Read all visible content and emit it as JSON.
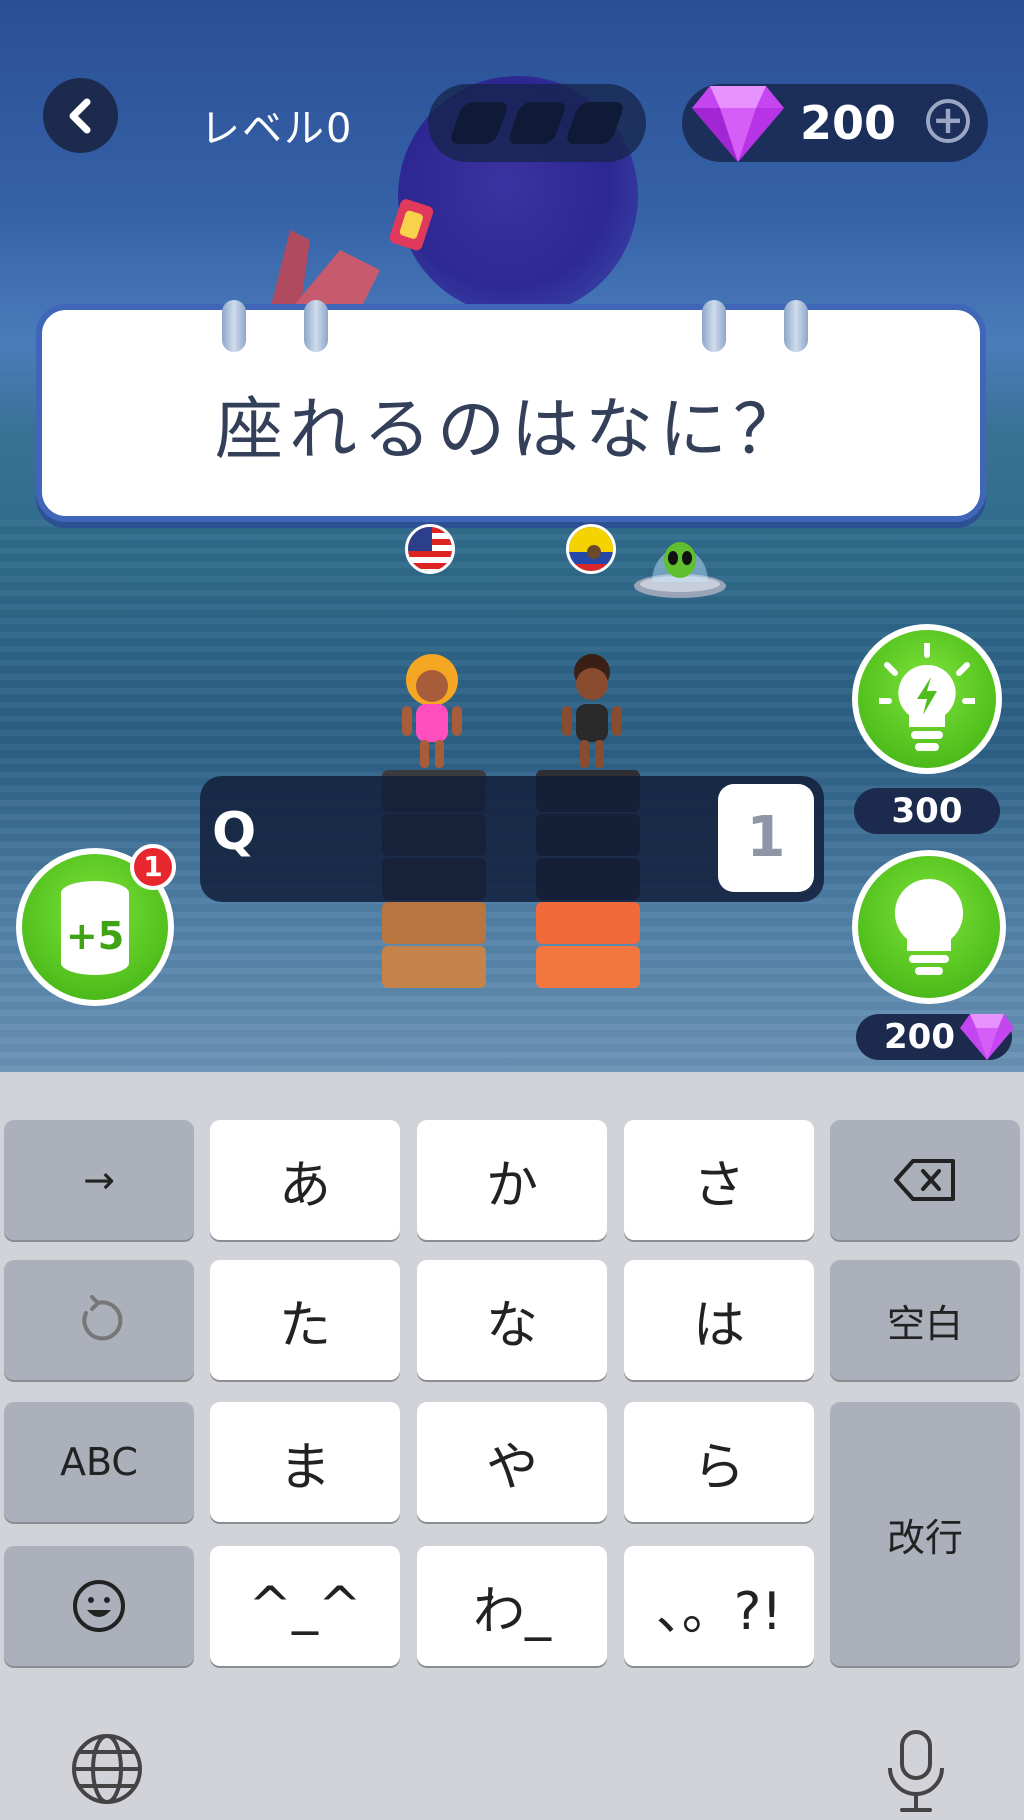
{
  "header": {
    "level_label": "レベル0",
    "gem_count": "200",
    "plus_label": "+",
    "progress_segments": 3
  },
  "question": {
    "text": "座れるのはなに？"
  },
  "answer": {
    "prefix": "Q",
    "letter_count": "1"
  },
  "powerups": {
    "plus5_label": "+5",
    "plus5_badge": "1",
    "energy_hint_cost": "300",
    "bulb_hint_cost": "200"
  },
  "keyboard": {
    "rows": [
      [
        "→",
        "あ",
        "か",
        "さ",
        "⌫"
      ],
      [
        "↺",
        "た",
        "な",
        "は",
        "空白"
      ],
      [
        "ABC",
        "ま",
        "や",
        "ら",
        "改行"
      ],
      [
        "☺",
        "^_^",
        "わ_",
        "、。?!"
      ]
    ],
    "globe_icon": "globe-icon",
    "mic_icon": "microphone-icon"
  },
  "colors": {
    "accent_green": "#4fbe1c",
    "gem_purple": "#c545f0",
    "panel_navy": "#1b2a4d",
    "card_border": "#3f66b8"
  }
}
